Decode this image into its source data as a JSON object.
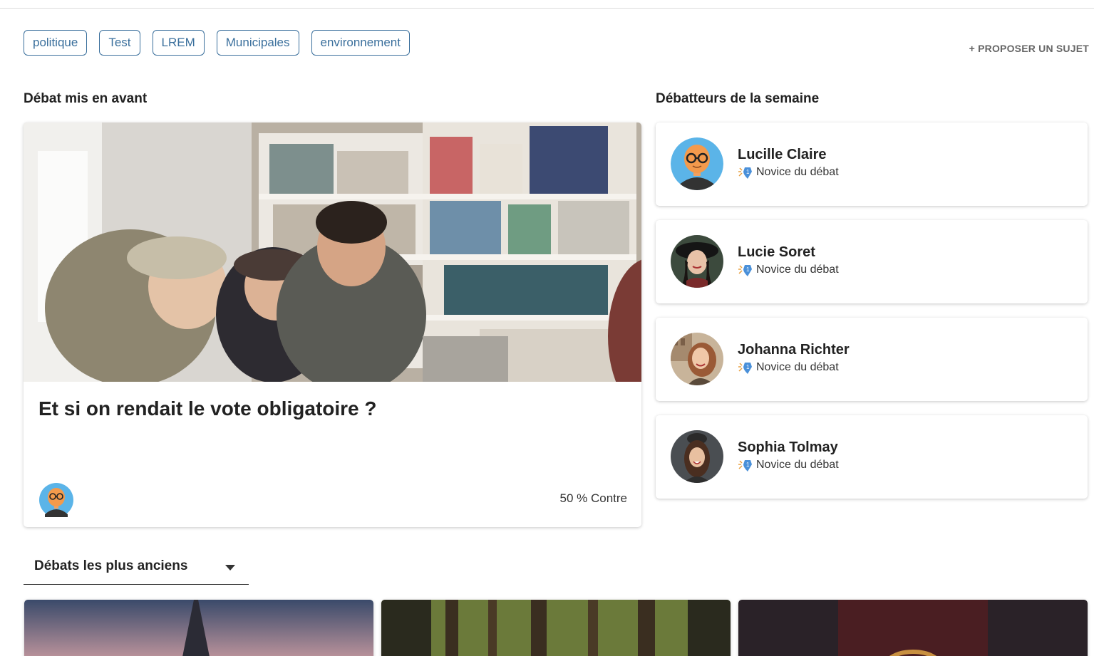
{
  "tags": [
    "politique",
    "Test",
    "LREM",
    "Municipales",
    "environnement"
  ],
  "propose_subject": "+ PROPOSER UN SUJET",
  "featured": {
    "section_title": "Débat mis en avant",
    "title": "Et si on rendait le vote obligatoire ?",
    "stat": "50 % Contre"
  },
  "debaters": {
    "section_title": "Débatteurs de la semaine",
    "items": [
      {
        "name": "Lucille Claire",
        "rank": "Novice du débat"
      },
      {
        "name": "Lucie Soret",
        "rank": "Novice du débat"
      },
      {
        "name": "Johanna Richter",
        "rank": "Novice du débat"
      },
      {
        "name": "Sophia Tolmay",
        "rank": "Novice du débat"
      }
    ]
  },
  "sort": {
    "label": "Débats les plus anciens"
  },
  "colors": {
    "accent": "#3a6f9c",
    "text": "#222222",
    "badge": "#4a90d9"
  }
}
